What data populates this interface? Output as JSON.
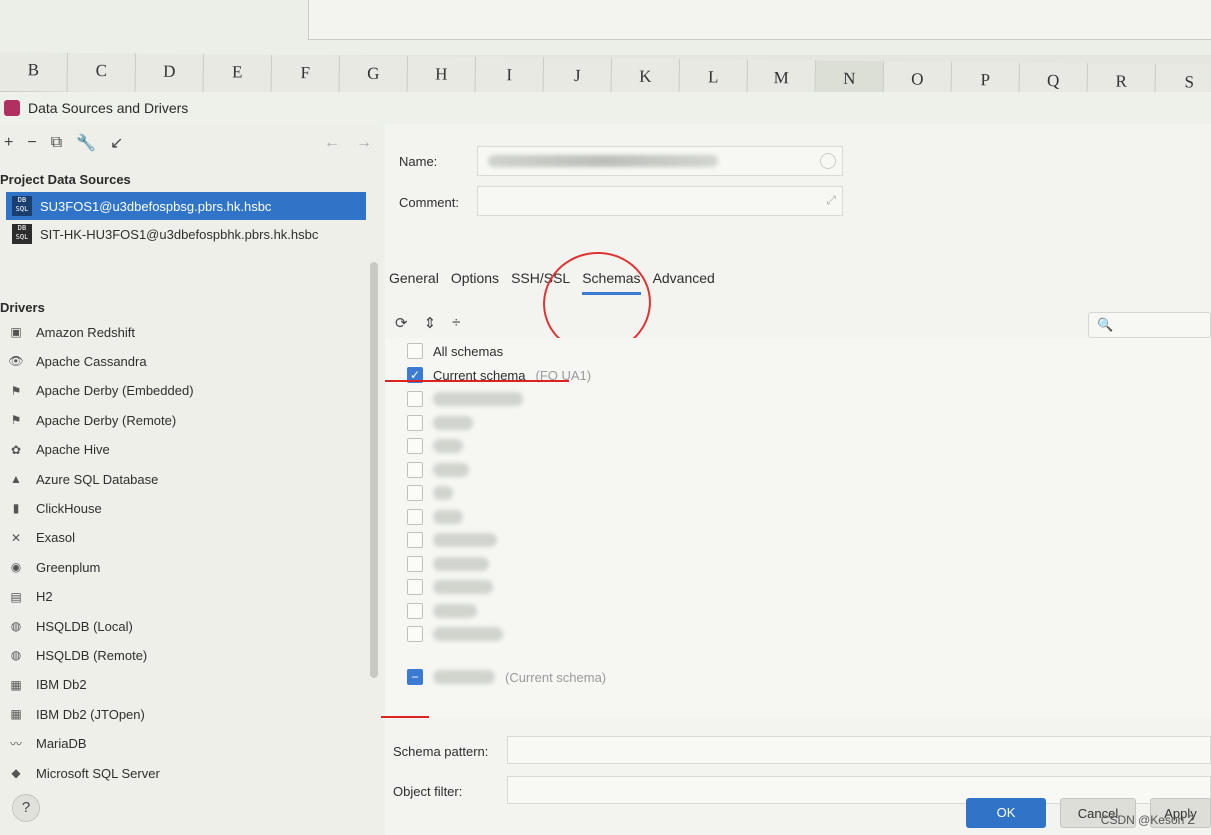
{
  "sheet": {
    "columns": [
      "B",
      "C",
      "D",
      "E",
      "F",
      "G",
      "H",
      "I",
      "J",
      "K",
      "L",
      "M",
      "N",
      "O",
      "P",
      "Q",
      "R",
      "S"
    ],
    "selected_column": "N"
  },
  "dialog": {
    "title": "Data Sources and Drivers",
    "toolbar": {
      "add": "+",
      "remove": "−",
      "copy": "⧉",
      "wrench": "🔧",
      "import": "↙",
      "back": "←",
      "forward": "→"
    },
    "project_sources_heading": "Project Data Sources",
    "data_sources": [
      {
        "name": "SU3FOS1@u3dbefospbsg.pbrs.hk.hsbc",
        "selected": true
      },
      {
        "name": "SIT-HK-HU3FOS1@u3dbefospbhk.pbrs.hk.hsbc",
        "selected": false
      }
    ],
    "drivers_heading": "Drivers",
    "drivers": [
      {
        "name": "Amazon Redshift",
        "icon": "redshift-icon",
        "glyph": "▣"
      },
      {
        "name": "Apache Cassandra",
        "icon": "cassandra-icon",
        "glyph": "👁"
      },
      {
        "name": "Apache Derby (Embedded)",
        "icon": "derby-icon",
        "glyph": "⚑"
      },
      {
        "name": "Apache Derby (Remote)",
        "icon": "derby-icon",
        "glyph": "⚑"
      },
      {
        "name": "Apache Hive",
        "icon": "hive-icon",
        "glyph": "✿"
      },
      {
        "name": "Azure SQL Database",
        "icon": "azure-icon",
        "glyph": "▲"
      },
      {
        "name": "ClickHouse",
        "icon": "clickhouse-icon",
        "glyph": "▮"
      },
      {
        "name": "Exasol",
        "icon": "exasol-icon",
        "glyph": "✕"
      },
      {
        "name": "Greenplum",
        "icon": "greenplum-icon",
        "glyph": "◉"
      },
      {
        "name": "H2",
        "icon": "h2-icon",
        "glyph": "▤"
      },
      {
        "name": "HSQLDB (Local)",
        "icon": "hsqldb-icon",
        "glyph": "◍"
      },
      {
        "name": "HSQLDB (Remote)",
        "icon": "hsqldb-icon",
        "glyph": "◍"
      },
      {
        "name": "IBM Db2",
        "icon": "db2-icon",
        "glyph": "▦"
      },
      {
        "name": "IBM Db2 (JTOpen)",
        "icon": "db2-icon",
        "glyph": "▦"
      },
      {
        "name": "MariaDB",
        "icon": "mariadb-icon",
        "glyph": "〰"
      },
      {
        "name": "Microsoft SQL Server",
        "icon": "mssql-icon",
        "glyph": "◆"
      }
    ],
    "help": "?",
    "form": {
      "name_label": "Name:",
      "comment_label": "Comment:"
    },
    "tabs": [
      {
        "label": "General",
        "active": false
      },
      {
        "label": "Options",
        "active": false
      },
      {
        "label": "SSH/SSL",
        "active": false
      },
      {
        "label": "Schemas",
        "active": true
      },
      {
        "label": "Advanced",
        "active": false
      }
    ],
    "schema_tools": {
      "refresh": "⟳",
      "expand": "⇕",
      "collapse": "÷"
    },
    "search_glyph": "🔍",
    "schemas": {
      "all_label": "All schemas",
      "current_label": "Current schema",
      "current_value": "(FO   UA1)",
      "current_suffix": "(Current schema)"
    },
    "schema_pattern_label": "Schema pattern:",
    "object_filter_label": "Object filter:",
    "ok_label": "OK",
    "cancel_label": "Cancel",
    "apply_label": "Apply"
  },
  "watermark": "CSDN @Keson Z",
  "colors": {
    "accent": "#2f74c6",
    "annotation": "#d33"
  }
}
